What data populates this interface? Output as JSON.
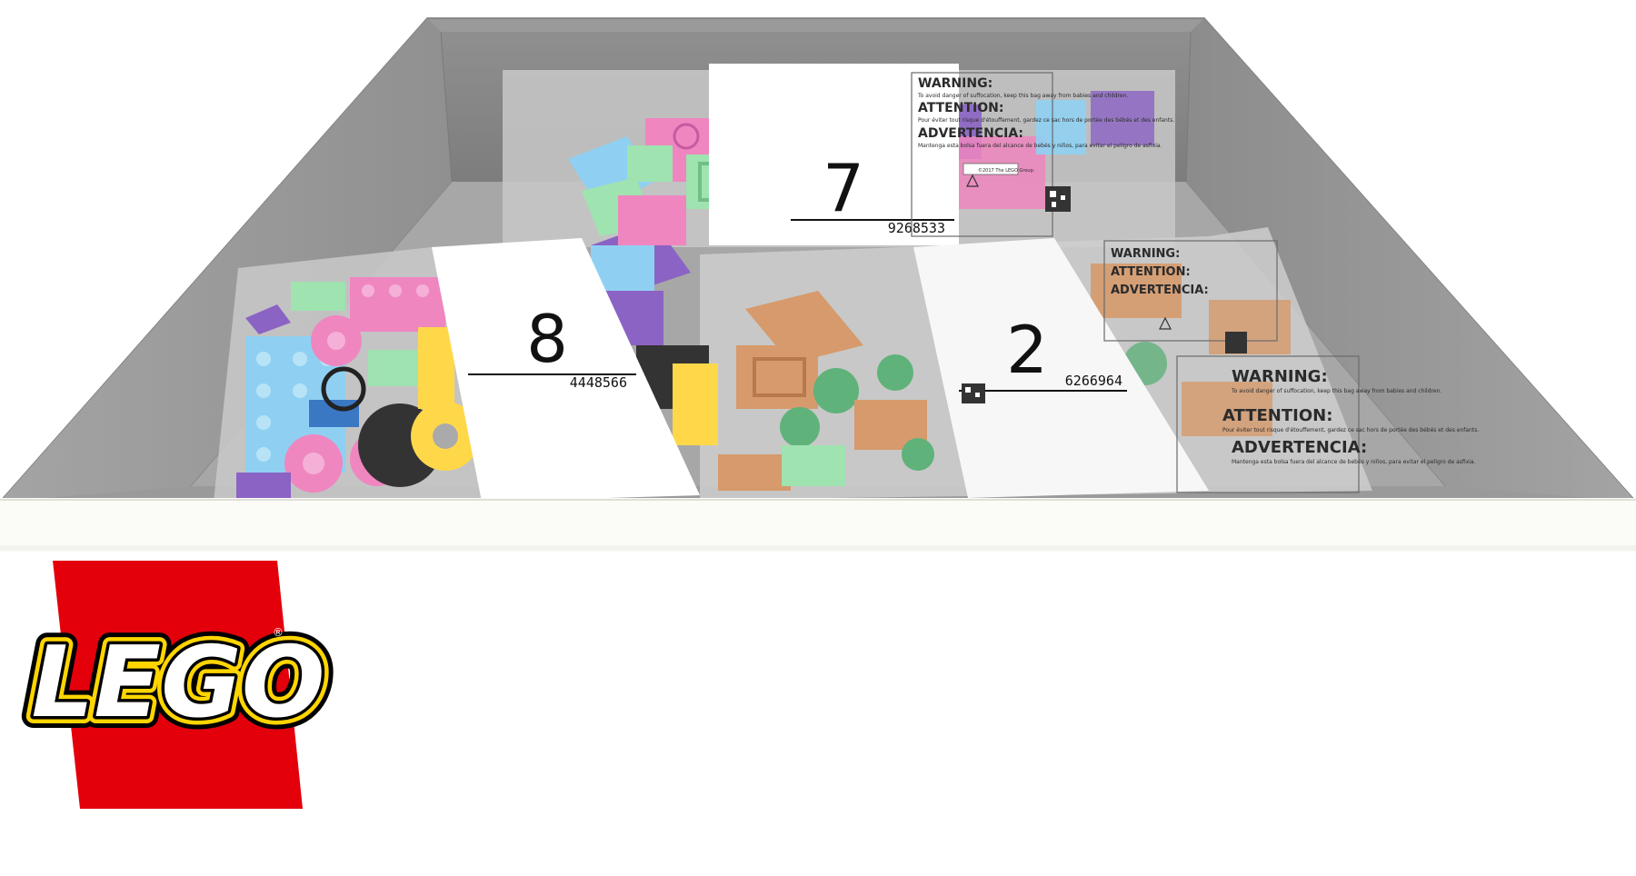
{
  "bags": [
    {
      "number": "7",
      "code": "9268533"
    },
    {
      "number": "8",
      "code": "4448566"
    },
    {
      "number": "2",
      "code": "6266964"
    }
  ],
  "warning_panel": {
    "warning_title": "WARNING:",
    "warning_text": "To avoid danger of suffocation, keep this bag away from babies and children.",
    "attention_title": "ATTENTION:",
    "attention_text": "Pour éviter tout risque d'étouffement, gardez ce sac hors de portée des bébés et des enfants.",
    "advertencia_title": "ADVERTENCIA:",
    "advertencia_text": "Mantenga esta bolsa fuera del alcance de bebés y niños, para evitar el peligro de asfixia.",
    "copyright": "©2017 The LEGO Group."
  },
  "logo": {
    "text": "LEGO",
    "registered": "®",
    "colors": {
      "red": "#e3000b",
      "yellow": "#ffd500",
      "white": "#ffffff",
      "black": "#000000"
    }
  },
  "colors": {
    "tray_back": "#8c8c8c",
    "tray_floor": "#a9a9a9",
    "tray_side": "#9e9e9e",
    "tray_rim": "#fbfbf7",
    "pink": "#ef86c0",
    "blue": "#8fd0f2",
    "green": "#9fe3b0",
    "purple": "#8b63c4",
    "tan": "#d69a6c",
    "leaf": "#5fb27a"
  }
}
